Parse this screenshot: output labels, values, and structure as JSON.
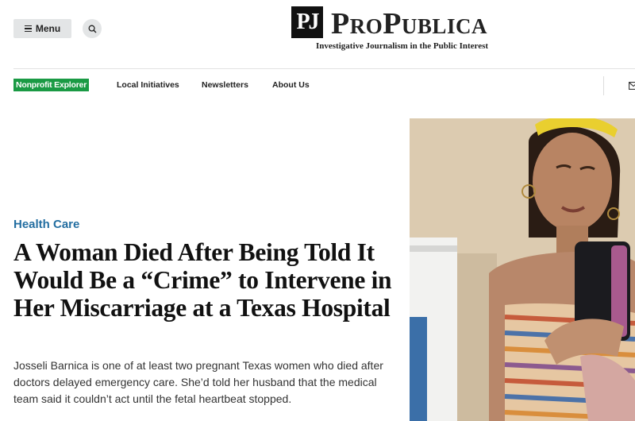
{
  "header": {
    "menu_label": "Menu",
    "icons": [
      "hamburger-icon",
      "search-icon"
    ],
    "logo_mark": "PJ",
    "logo_name": "ProPublica",
    "tagline": "Investigative Journalism in the Public Interest"
  },
  "nav": {
    "badge": "Nonprofit Explorer",
    "links": [
      "Local Initiatives",
      "Newsletters",
      "About Us"
    ],
    "right_icon": "mail-icon"
  },
  "article": {
    "kicker": "Health Care",
    "headline": "A Woman Died After Being Told It Would Be a “Crime” to Intervene in Her Miscarriage at a Texas Hospital",
    "dek": "Josseli Barnica is one of at least two pregnant Texas women who died after doctors delayed emergency care. She’d told her husband that the medical team said it couldn’t act until the fetal heartbeat stopped."
  },
  "colors": {
    "kicker": "#236ea1",
    "badge": "#1a9a44",
    "button_bg": "#e3e5e6"
  }
}
